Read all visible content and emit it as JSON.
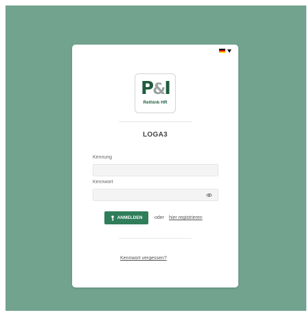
{
  "language": {
    "selected_flag": "de-flag-icon",
    "flag_colors": [
      "#000000",
      "#dd0000",
      "#ffce00"
    ]
  },
  "logo": {
    "mark_p": "P",
    "mark_amp": "&",
    "mark_i": "I",
    "tagline": "Rethink HR"
  },
  "brand": {
    "name": "LOGA3"
  },
  "form": {
    "username_label": "Kennung",
    "username_value": "",
    "password_label": "Kennwort",
    "password_value": ""
  },
  "actions": {
    "login_label": "ANMELDEN",
    "or_text": "oder",
    "register_label": "hier registrieren",
    "forgot_label": "Kennwort vergessen?"
  },
  "colors": {
    "background": "#72a38f",
    "accent": "#2f7d5a",
    "logo_green": "#1f5c3e"
  }
}
